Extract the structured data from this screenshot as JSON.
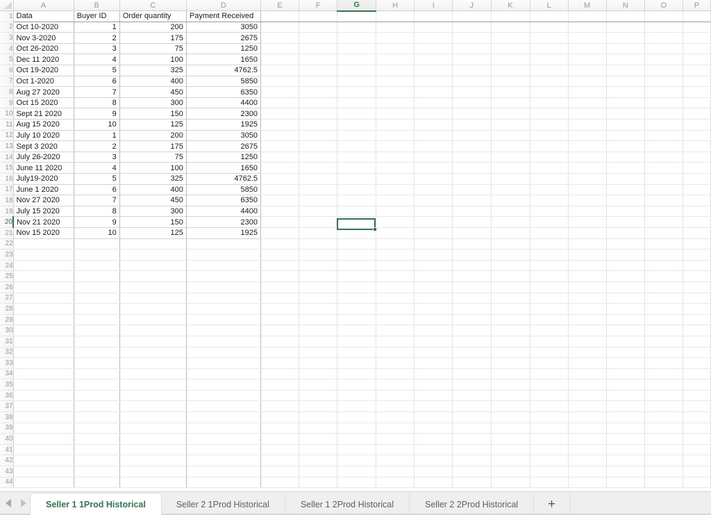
{
  "sheet": {
    "columns": [
      "A",
      "B",
      "C",
      "D",
      "E",
      "F",
      "G",
      "H",
      "I",
      "J",
      "K",
      "L",
      "M",
      "N",
      "O",
      "P"
    ],
    "selected_column": "G",
    "selected_row": 20,
    "selected_cell": "G20",
    "total_rows": 44,
    "accent_color": "#2c7a4b",
    "header_text_color": "#9a9a9a",
    "headers": {
      "a": "Data",
      "b": "Buyer ID",
      "c": "Order quantity",
      "d": "Payment Received"
    },
    "rows": [
      {
        "row": 2,
        "date": "Oct 10-2020",
        "buyer_id": "1",
        "order_quantity": "200",
        "payment_received": "3050"
      },
      {
        "row": 3,
        "date": "Nov 3-2020",
        "buyer_id": "2",
        "order_quantity": "175",
        "payment_received": "2675"
      },
      {
        "row": 4,
        "date": "Oct 26-2020",
        "buyer_id": "3",
        "order_quantity": "75",
        "payment_received": "1250"
      },
      {
        "row": 5,
        "date": "Dec 11 2020",
        "buyer_id": "4",
        "order_quantity": "100",
        "payment_received": "1650"
      },
      {
        "row": 6,
        "date": "Oct 19-2020",
        "buyer_id": "5",
        "order_quantity": "325",
        "payment_received": "4762.5"
      },
      {
        "row": 7,
        "date": "Oct 1-2020",
        "buyer_id": "6",
        "order_quantity": "400",
        "payment_received": "5850"
      },
      {
        "row": 8,
        "date": "Aug 27 2020",
        "buyer_id": "7",
        "order_quantity": "450",
        "payment_received": "6350"
      },
      {
        "row": 9,
        "date": "Oct 15 2020",
        "buyer_id": "8",
        "order_quantity": "300",
        "payment_received": "4400"
      },
      {
        "row": 10,
        "date": "Sept 21 2020",
        "buyer_id": "9",
        "order_quantity": "150",
        "payment_received": "2300"
      },
      {
        "row": 11,
        "date": "Aug 15 2020",
        "buyer_id": "10",
        "order_quantity": "125",
        "payment_received": "1925"
      },
      {
        "row": 12,
        "date": "July 10 2020",
        "buyer_id": "1",
        "order_quantity": "200",
        "payment_received": "3050"
      },
      {
        "row": 13,
        "date": "Sept 3 2020",
        "buyer_id": "2",
        "order_quantity": "175",
        "payment_received": "2675"
      },
      {
        "row": 14,
        "date": "July 26-2020",
        "buyer_id": "3",
        "order_quantity": "75",
        "payment_received": "1250"
      },
      {
        "row": 15,
        "date": "June 11 2020",
        "buyer_id": "4",
        "order_quantity": "100",
        "payment_received": "1650"
      },
      {
        "row": 16,
        "date": "July19-2020",
        "buyer_id": "5",
        "order_quantity": "325",
        "payment_received": "4762.5"
      },
      {
        "row": 17,
        "date": "June 1 2020",
        "buyer_id": "6",
        "order_quantity": "400",
        "payment_received": "5850"
      },
      {
        "row": 18,
        "date": "Nov 27 2020",
        "buyer_id": "7",
        "order_quantity": "450",
        "payment_received": "6350"
      },
      {
        "row": 19,
        "date": "July 15 2020",
        "buyer_id": "8",
        "order_quantity": "300",
        "payment_received": "4400"
      },
      {
        "row": 20,
        "date": "Nov 21 2020",
        "buyer_id": "9",
        "order_quantity": "150",
        "payment_received": "2300"
      },
      {
        "row": 21,
        "date": "Nov 15 2020",
        "buyer_id": "10",
        "order_quantity": "125",
        "payment_received": "1925"
      }
    ]
  },
  "tabbar": {
    "prev_icon": "triangle-left-icon",
    "next_icon": "triangle-right-icon",
    "add_label": "+",
    "tabs": [
      {
        "label": "Seller 1 1Prod Historical",
        "active": true
      },
      {
        "label": "Seller 2 1Prod Historical",
        "active": false
      },
      {
        "label": "Seller 1 2Prod Historical",
        "active": false
      },
      {
        "label": "Seller 2 2Prod Historical",
        "active": false
      }
    ]
  }
}
